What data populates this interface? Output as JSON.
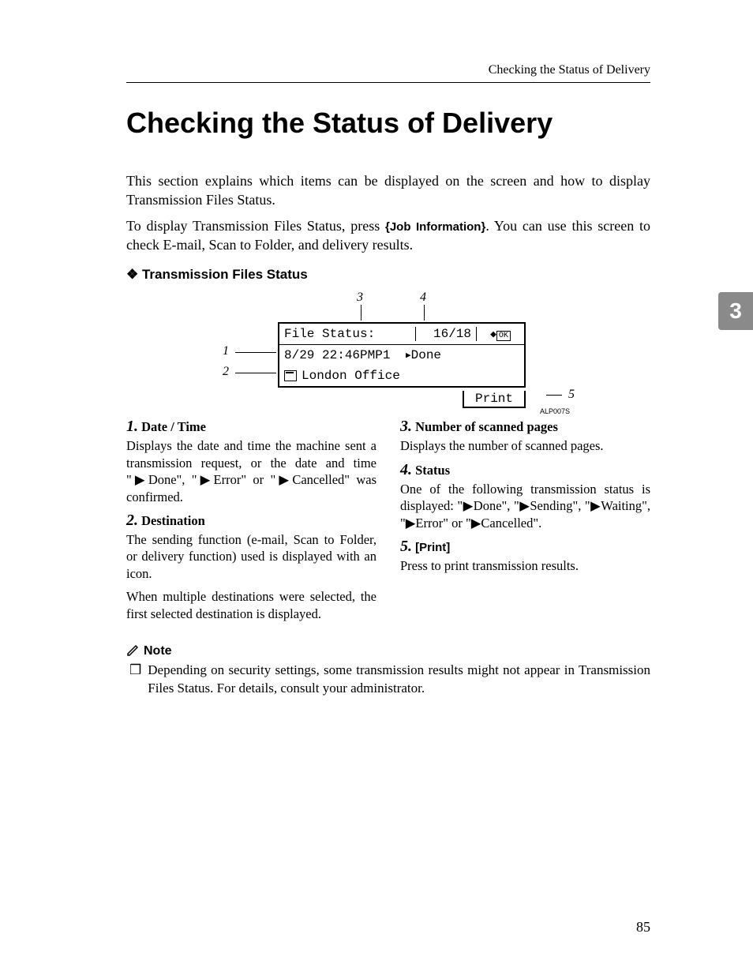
{
  "running_header": "Checking the Status of Delivery",
  "title": "Checking the Status of Delivery",
  "intro": {
    "p1": "This section explains which items can be displayed on the screen and how to display Transmission Files Status.",
    "p2a": "To display Transmission Files Status, press ",
    "key": "Job Information",
    "p2b": ". You can use this screen to check E-mail, Scan to Folder, and delivery results."
  },
  "subhead": "Transmission Files Status",
  "diagram": {
    "callouts": {
      "c1": "1",
      "c2": "2",
      "c3": "3",
      "c4": "4",
      "c5": "5"
    },
    "lcd": {
      "title": "File Status:",
      "page": "16/18",
      "ok": "OK",
      "line1_left": "8/29 22:46PMP1",
      "line1_right": "Done",
      "line2": "London Office",
      "print": "Print"
    },
    "caption": "ALP007S"
  },
  "items": {
    "i1": {
      "num": "1.",
      "label": "Date / Time",
      "body": "Displays the date and time the machine sent a transmission request, or the date and time \"▶Done\", \"▶Error\" or \"▶Cancelled\" was confirmed."
    },
    "i2": {
      "num": "2.",
      "label": "Destination",
      "body1": "The sending function (e-mail, Scan to Folder, or delivery function) used is displayed with an icon.",
      "body2": "When multiple destinations were selected, the first selected destination is displayed."
    },
    "i3": {
      "num": "3.",
      "label": "Number of scanned pages",
      "body": "Displays the number of scanned pages."
    },
    "i4": {
      "num": "4.",
      "label": "Status",
      "body": "One of the following transmission status is displayed: \"▶Done\", \"▶Sending\", \"▶Waiting\", \"▶Error\" or \"▶Cancelled\"."
    },
    "i5": {
      "num": "5.",
      "label": "[Print]",
      "body": "Press to print transmission results."
    }
  },
  "note": {
    "heading": "Note",
    "bullet": "❒",
    "body": "Depending on security settings, some transmission results might not appear in Transmission Files Status. For details, consult your administrator."
  },
  "thumb_tab": "3",
  "page_number": "85"
}
